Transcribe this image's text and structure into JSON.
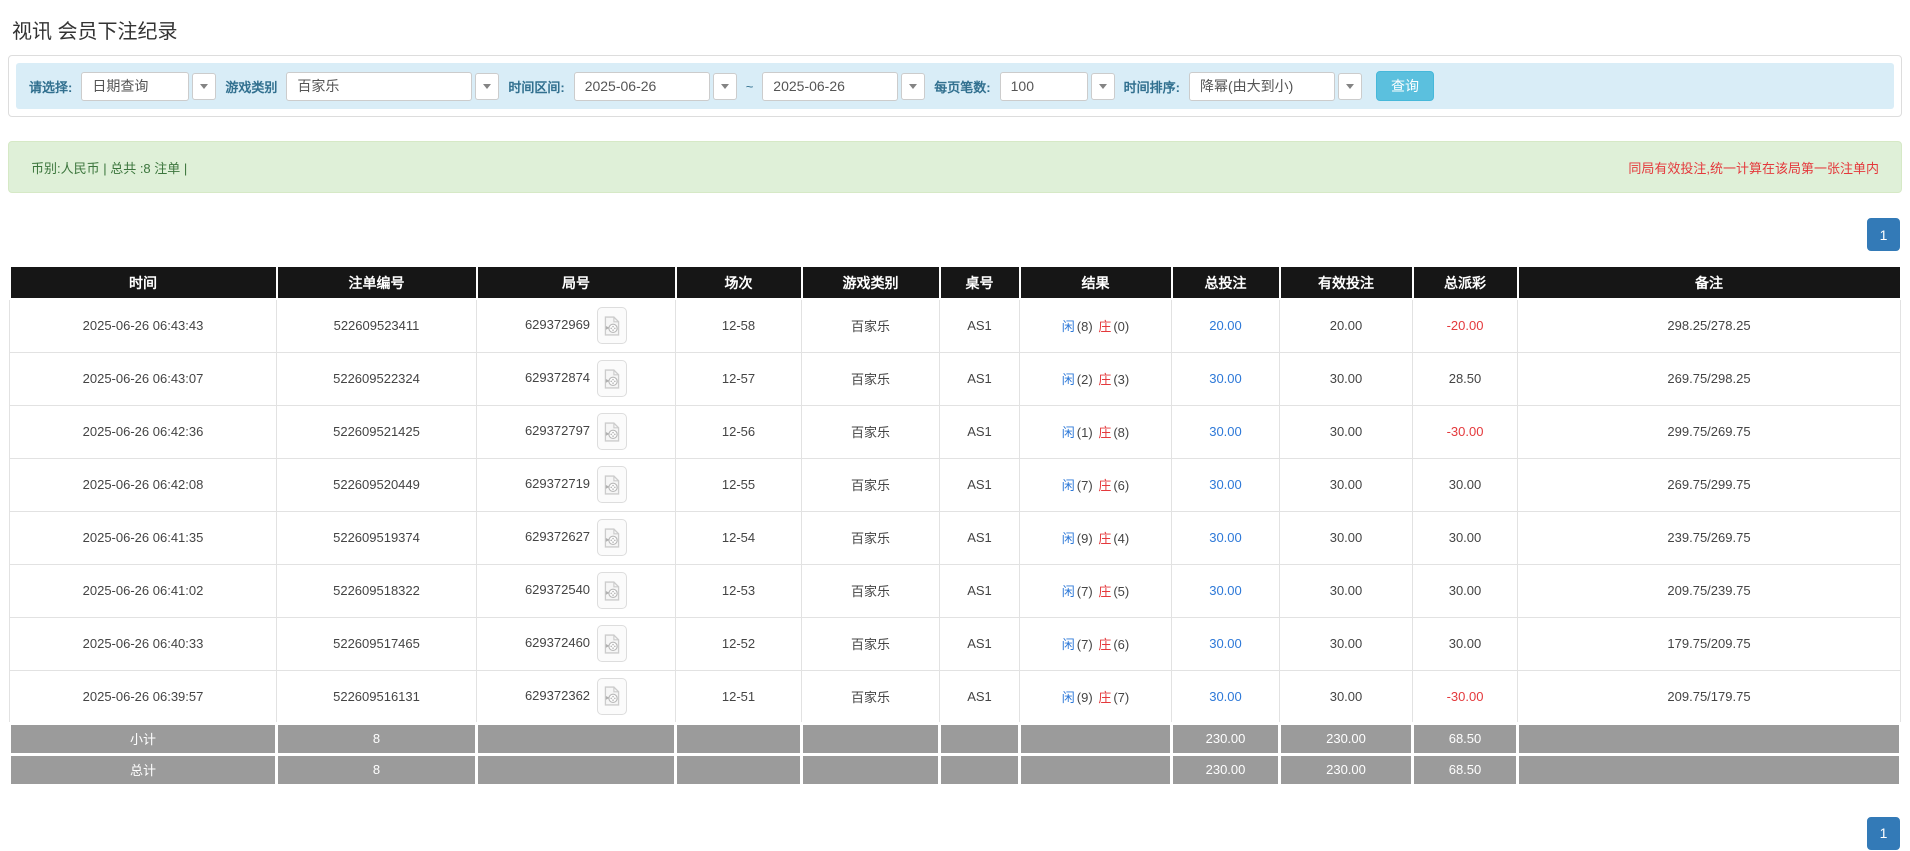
{
  "page": {
    "title": "视讯 会员下注纪录"
  },
  "filters": {
    "select_label": "请选择:",
    "select_value": "日期查询",
    "game_type_label": "游戏类别",
    "game_type_value": "百家乐",
    "time_range_label": "时间区间:",
    "date_from": "2025-06-26",
    "date_separator": "~",
    "date_to": "2025-06-26",
    "page_size_label": "每页笔数:",
    "page_size_value": "100",
    "sort_label": "时间排序:",
    "sort_value": "降幂(由大到小)",
    "search_button": "查询"
  },
  "summary": {
    "left_text": "币别:人民币 | 总共 :8 注单 |",
    "right_notice": "同局有效投注,统一计算在该局第一张注单内"
  },
  "pagination": {
    "page": "1"
  },
  "icons": {
    "video_replay": "film-file-icon",
    "dropdown_caret": "▼"
  },
  "colors": {
    "filter_bar_bg": "#d9edf7",
    "filter_label": "#31708f",
    "summary_bg": "#dff0d8",
    "summary_text_green": "#3c763d",
    "notice_red": "#e4393c",
    "header_bg": "#161616",
    "footer_bg": "#9b9b9b",
    "link_blue": "#2e79d8",
    "pagination_blue": "#337ab7",
    "search_button_bg": "#5bc0de"
  },
  "table": {
    "headers": [
      "时间",
      "注单编号",
      "局号",
      "场次",
      "游戏类别",
      "桌号",
      "结果",
      "总投注",
      "有效投注",
      "总派彩",
      "备注"
    ],
    "rows": [
      {
        "time": "2025-06-26 06:43:43",
        "bet_id": "522609523411",
        "round_id": "629372969",
        "session": "12-58",
        "game": "百家乐",
        "table_no": "AS1",
        "result_p": "闲",
        "result_p_n": "(8)",
        "result_b": "庄",
        "result_b_n": "(0)",
        "total_bet": "20.00",
        "valid_bet": "20.00",
        "payout": "-20.00",
        "remark": "298.25/278.25"
      },
      {
        "time": "2025-06-26 06:43:07",
        "bet_id": "522609522324",
        "round_id": "629372874",
        "session": "12-57",
        "game": "百家乐",
        "table_no": "AS1",
        "result_p": "闲",
        "result_p_n": "(2)",
        "result_b": "庄",
        "result_b_n": "(3)",
        "total_bet": "30.00",
        "valid_bet": "30.00",
        "payout": "28.50",
        "remark": "269.75/298.25"
      },
      {
        "time": "2025-06-26 06:42:36",
        "bet_id": "522609521425",
        "round_id": "629372797",
        "session": "12-56",
        "game": "百家乐",
        "table_no": "AS1",
        "result_p": "闲",
        "result_p_n": "(1)",
        "result_b": "庄",
        "result_b_n": "(8)",
        "total_bet": "30.00",
        "valid_bet": "30.00",
        "payout": "-30.00",
        "remark": "299.75/269.75"
      },
      {
        "time": "2025-06-26 06:42:08",
        "bet_id": "522609520449",
        "round_id": "629372719",
        "session": "12-55",
        "game": "百家乐",
        "table_no": "AS1",
        "result_p": "闲",
        "result_p_n": "(7)",
        "result_b": "庄",
        "result_b_n": "(6)",
        "total_bet": "30.00",
        "valid_bet": "30.00",
        "payout": "30.00",
        "remark": "269.75/299.75"
      },
      {
        "time": "2025-06-26 06:41:35",
        "bet_id": "522609519374",
        "round_id": "629372627",
        "session": "12-54",
        "game": "百家乐",
        "table_no": "AS1",
        "result_p": "闲",
        "result_p_n": "(9)",
        "result_b": "庄",
        "result_b_n": "(4)",
        "total_bet": "30.00",
        "valid_bet": "30.00",
        "payout": "30.00",
        "remark": "239.75/269.75"
      },
      {
        "time": "2025-06-26 06:41:02",
        "bet_id": "522609518322",
        "round_id": "629372540",
        "session": "12-53",
        "game": "百家乐",
        "table_no": "AS1",
        "result_p": "闲",
        "result_p_n": "(7)",
        "result_b": "庄",
        "result_b_n": "(5)",
        "total_bet": "30.00",
        "valid_bet": "30.00",
        "payout": "30.00",
        "remark": "209.75/239.75"
      },
      {
        "time": "2025-06-26 06:40:33",
        "bet_id": "522609517465",
        "round_id": "629372460",
        "session": "12-52",
        "game": "百家乐",
        "table_no": "AS1",
        "result_p": "闲",
        "result_p_n": "(7)",
        "result_b": "庄",
        "result_b_n": "(6)",
        "total_bet": "30.00",
        "valid_bet": "30.00",
        "payout": "30.00",
        "remark": "179.75/209.75"
      },
      {
        "time": "2025-06-26 06:39:57",
        "bet_id": "522609516131",
        "round_id": "629372362",
        "session": "12-51",
        "game": "百家乐",
        "table_no": "AS1",
        "result_p": "闲",
        "result_p_n": "(9)",
        "result_b": "庄",
        "result_b_n": "(7)",
        "total_bet": "30.00",
        "valid_bet": "30.00",
        "payout": "-30.00",
        "remark": "209.75/179.75"
      }
    ],
    "subtotal": {
      "label": "小计",
      "count": "8",
      "total_bet": "230.00",
      "valid_bet": "230.00",
      "payout": "68.50"
    },
    "total": {
      "label": "总计",
      "count": "8",
      "total_bet": "230.00",
      "valid_bet": "230.00",
      "payout": "68.50"
    }
  }
}
